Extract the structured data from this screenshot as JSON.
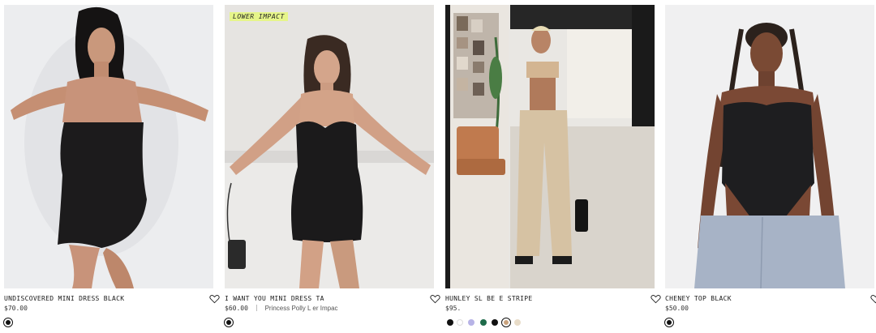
{
  "products": [
    {
      "name": "UNDISCOVERED MINI DRESS BLACK",
      "price": "$70.00",
      "tag": "",
      "badge": "",
      "swatches": [
        "#111111"
      ]
    },
    {
      "name": "I WANT YOU MINI DRESS TA",
      "price": "$60.00",
      "tag": "Princess Polly L  er Impac",
      "badge": "LOWER IMPACT",
      "swatches": [
        "#111111"
      ]
    },
    {
      "name": "HUNLEY SL  BE  E STRIPE",
      "price": "$95.",
      "tag": "",
      "badge": "",
      "swatches": [
        "#111111",
        "#ffffff",
        "#b7b3e6",
        "#1e6b4a",
        "#111111",
        "#c9a27c",
        "#e8dcc8"
      ]
    },
    {
      "name": "CHENEY TOP BLACK",
      "price": "$50.00",
      "tag": "",
      "badge": "",
      "swatches": [
        "#111111"
      ]
    }
  ],
  "icons": {
    "wishlist": "heart-outline-icon"
  },
  "colors": {
    "badge_bg": "#e6f58a",
    "text": "#1a1a1a"
  }
}
